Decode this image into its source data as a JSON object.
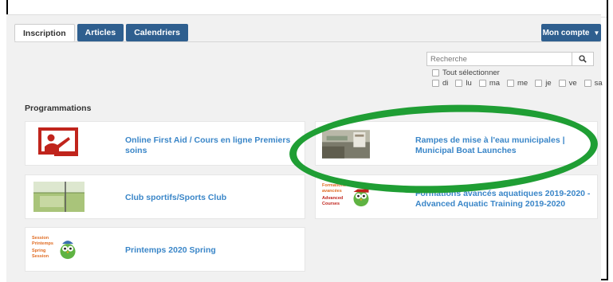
{
  "tabs": [
    {
      "label": "Inscription",
      "active": true
    },
    {
      "label": "Articles",
      "active": false
    },
    {
      "label": "Calendriers",
      "active": false
    }
  ],
  "account": {
    "label": "Mon compte",
    "icon": "caret-down-icon"
  },
  "search": {
    "placeholder": "Recherche",
    "icon": "search-icon"
  },
  "filters": {
    "select_all": "Tout sélectionner",
    "days": [
      "di",
      "lu",
      "ma",
      "me",
      "je",
      "ve",
      "sa"
    ]
  },
  "section_title": "Programmations",
  "programs": [
    {
      "title": "Online First Aid / Cours en ligne Premiers soins"
    },
    {
      "title": "Rampes de mise à l'eau municipales | Municipal Boat Launches"
    },
    {
      "title": "Club sportifs/Sports Club"
    },
    {
      "title": "Formations avancés aquatiques 2019-2020 - Advanced Aquatic Training 2019-2020",
      "thumb_text": [
        "Formations",
        "avancées",
        "Advanced",
        "Courses"
      ]
    },
    {
      "title": "Printemps 2020 Spring",
      "thumb_text": [
        "Session",
        "Printemps",
        "Spring",
        "Session"
      ]
    }
  ],
  "colors": {
    "accent": "#2f5f8f",
    "link": "#3a86c8",
    "highlight": "#1f9e34",
    "first_aid_red": "#c0241c"
  }
}
